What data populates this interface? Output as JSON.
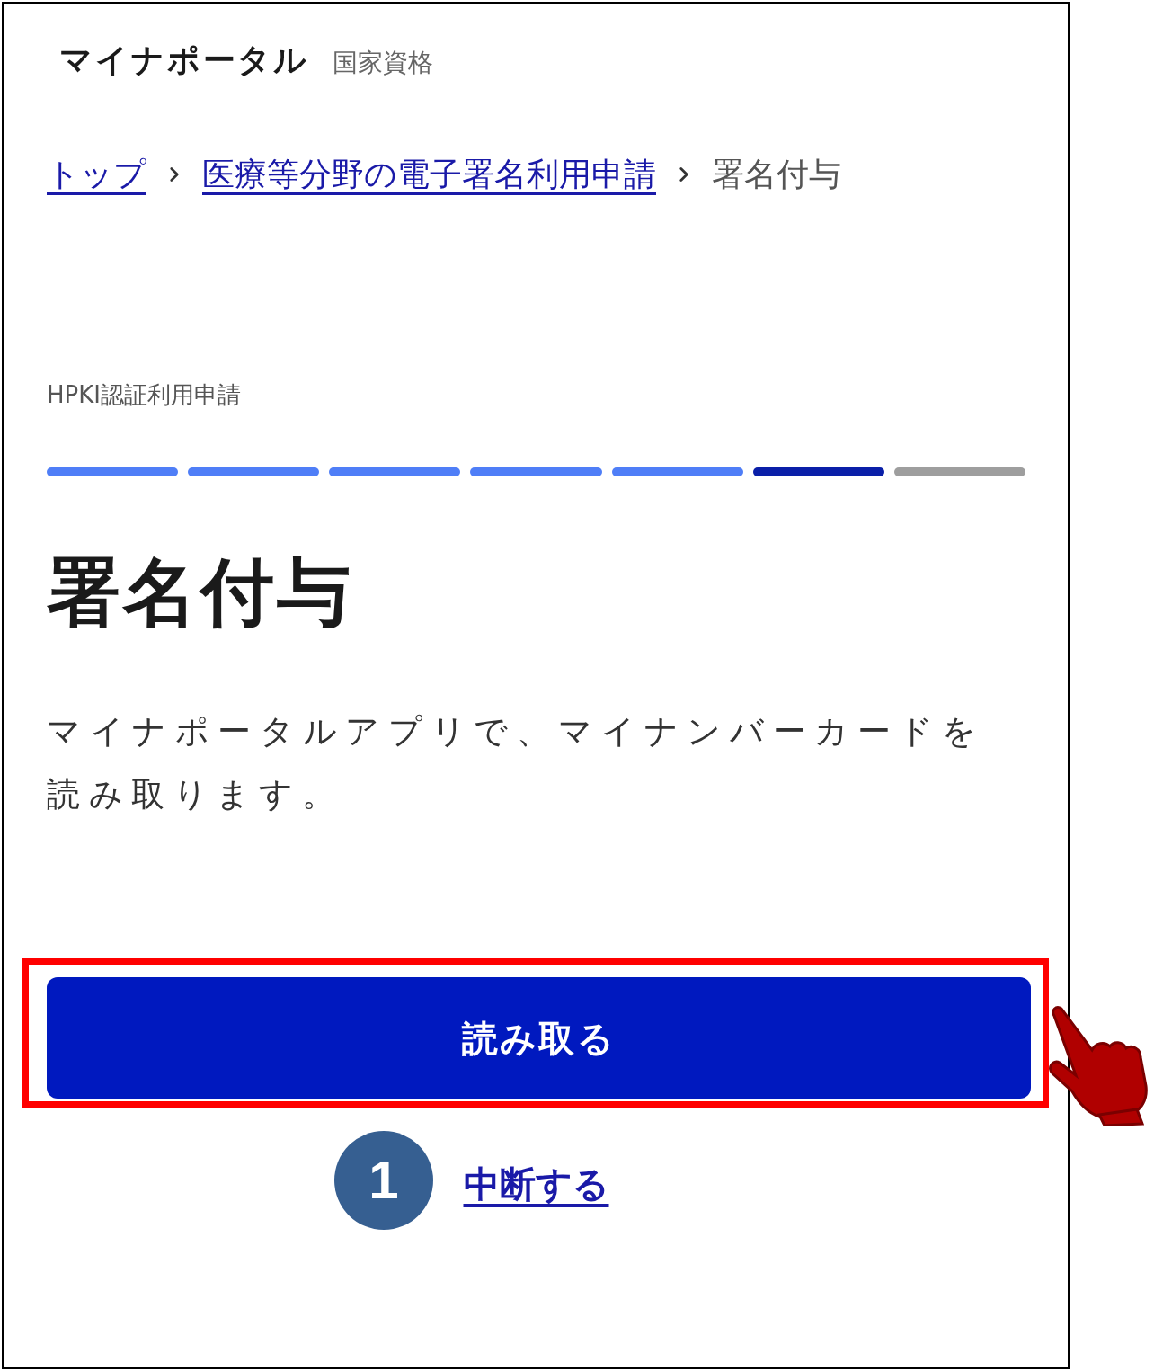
{
  "header": {
    "title": "マイナポータル",
    "subtitle": "国家資格"
  },
  "breadcrumb": [
    {
      "label": "トップ",
      "kind": "link"
    },
    {
      "label": "医療等分野の電子署名利用申請",
      "kind": "link"
    },
    {
      "label": "署名付与",
      "kind": "current"
    }
  ],
  "step_label": "HPKI認証利用申請",
  "progress": [
    {
      "kind": "done"
    },
    {
      "kind": "done"
    },
    {
      "kind": "done"
    },
    {
      "kind": "done"
    },
    {
      "kind": "done"
    },
    {
      "kind": "current"
    },
    {
      "kind": "todo"
    }
  ],
  "heading": "署名付与",
  "description": "マイナポータルアプリで、マイナンバーカードを読み取ります。",
  "primary_button": {
    "label": "読み取る",
    "highlighted": true
  },
  "cancel_link": "中断する",
  "callout": {
    "number": "1"
  }
}
